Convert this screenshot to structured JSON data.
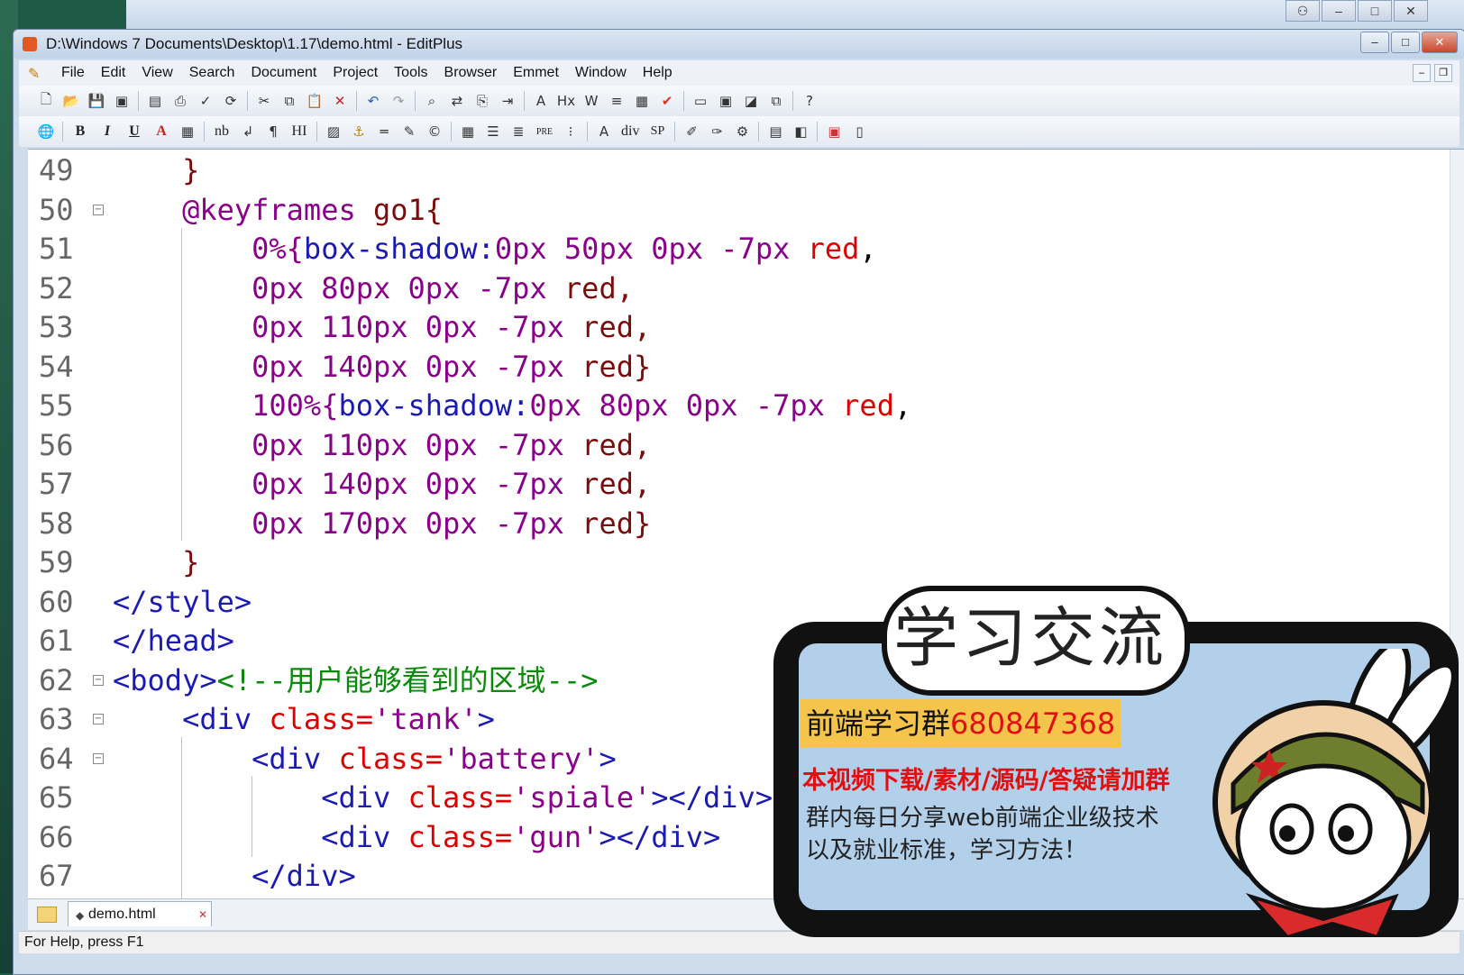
{
  "window": {
    "title": "D:\\Windows 7 Documents\\Desktop\\1.17\\demo.html - EditPlus",
    "controls": [
      "minimize-icon",
      "maximize-icon",
      "close-icon"
    ]
  },
  "menu": [
    "File",
    "Edit",
    "View",
    "Search",
    "Document",
    "Project",
    "Tools",
    "Browser",
    "Emmet",
    "Window",
    "Help"
  ],
  "toolbar1": [
    "new-file-icon",
    "open-icon",
    "save-icon",
    "save-all-icon",
    "print-preview-icon",
    "print-icon",
    "spellcheck-icon",
    "refresh-icon",
    "cut-icon",
    "copy-icon",
    "paste-icon",
    "delete-icon",
    "undo-icon",
    "redo-icon",
    "find-icon",
    "replace-icon",
    "find-in-files-icon",
    "goto-line-icon",
    "font-icon",
    "hex-icon",
    "word-wrap-icon",
    "line-number-icon",
    "column-icon",
    "check-icon",
    "view1-icon",
    "view2-icon",
    "view3-icon",
    "view4-icon",
    "help-icon"
  ],
  "toolbar2": {
    "text_buttons": [
      "B",
      "I",
      "U",
      "A",
      "nb",
      "HI",
      "div",
      "SP",
      "PRE"
    ]
  },
  "editor": {
    "lines": [
      {
        "n": "49",
        "fold": false,
        "tokens": [
          [
            "c-maroon",
            "    }"
          ]
        ]
      },
      {
        "n": "50",
        "fold": true,
        "tokens": [
          [
            "c-purple",
            "    @keyframes "
          ],
          [
            "c-maroon",
            "go1{"
          ]
        ]
      },
      {
        "n": "51",
        "fold": false,
        "tokens": [
          [
            "c-purple",
            "        0%{"
          ],
          [
            "c-navy",
            "box-shadow:"
          ],
          [
            "c-purple",
            "0px 50px 0px -7px "
          ],
          [
            "c-red",
            "red"
          ],
          [
            "c-black",
            ","
          ]
        ]
      },
      {
        "n": "52",
        "fold": false,
        "tokens": [
          [
            "c-purple",
            "        0px 80px 0px -7px "
          ],
          [
            "c-maroon",
            "red,"
          ]
        ]
      },
      {
        "n": "53",
        "fold": false,
        "tokens": [
          [
            "c-purple",
            "        0px 110px 0px -7px "
          ],
          [
            "c-maroon",
            "red,"
          ]
        ]
      },
      {
        "n": "54",
        "fold": false,
        "tokens": [
          [
            "c-purple",
            "        0px 140px 0px -7px "
          ],
          [
            "c-maroon",
            "red}"
          ]
        ]
      },
      {
        "n": "55",
        "fold": false,
        "tokens": [
          [
            "c-purple",
            "        100%{"
          ],
          [
            "c-navy",
            "box-shadow:"
          ],
          [
            "c-purple",
            "0px 80px 0px -7px "
          ],
          [
            "c-red",
            "red"
          ],
          [
            "c-black",
            ","
          ]
        ]
      },
      {
        "n": "56",
        "fold": false,
        "tokens": [
          [
            "c-purple",
            "        0px 110px 0px -7px "
          ],
          [
            "c-maroon",
            "red,"
          ]
        ]
      },
      {
        "n": "57",
        "fold": false,
        "tokens": [
          [
            "c-purple",
            "        0px 140px 0px -7px "
          ],
          [
            "c-maroon",
            "red,"
          ]
        ]
      },
      {
        "n": "58",
        "fold": false,
        "tokens": [
          [
            "c-purple",
            "        0px 170px 0px -7px "
          ],
          [
            "c-maroon",
            "red}"
          ]
        ]
      },
      {
        "n": "59",
        "fold": false,
        "tokens": [
          [
            "c-maroon",
            "    }"
          ]
        ]
      },
      {
        "n": "60",
        "fold": false,
        "tokens": [
          [
            "c-navy",
            "</style>"
          ]
        ]
      },
      {
        "n": "61",
        "fold": false,
        "tokens": [
          [
            "c-navy",
            "</head>"
          ]
        ]
      },
      {
        "n": "62",
        "fold": true,
        "tokens": [
          [
            "c-navy",
            "<body>"
          ],
          [
            "c-green",
            "<!--用户能够看到的区域-->"
          ]
        ]
      },
      {
        "n": "63",
        "fold": true,
        "tokens": [
          [
            "c-navy",
            "    <div "
          ],
          [
            "c-red",
            "class="
          ],
          [
            "c-purple",
            "'tank'"
          ],
          [
            "c-navy",
            ">"
          ]
        ]
      },
      {
        "n": "64",
        "fold": true,
        "tokens": [
          [
            "c-navy",
            "        <div "
          ],
          [
            "c-red",
            "class="
          ],
          [
            "c-purple",
            "'battery'"
          ],
          [
            "c-navy",
            ">"
          ]
        ]
      },
      {
        "n": "65",
        "fold": false,
        "tokens": [
          [
            "c-navy",
            "            <div "
          ],
          [
            "c-red",
            "class="
          ],
          [
            "c-purple",
            "'spiale'"
          ],
          [
            "c-navy",
            "></div>"
          ]
        ]
      },
      {
        "n": "66",
        "fold": false,
        "tokens": [
          [
            "c-navy",
            "            <div "
          ],
          [
            "c-red",
            "class="
          ],
          [
            "c-purple",
            "'gun'"
          ],
          [
            "c-navy",
            "></div>"
          ]
        ]
      },
      {
        "n": "67",
        "fold": false,
        "tokens": [
          [
            "c-navy",
            "        </div>"
          ]
        ]
      }
    ]
  },
  "tabs": [
    {
      "label": "demo.html"
    }
  ],
  "status": "For Help, press F1",
  "promo": {
    "heading": "学习交流",
    "group_label": "前端学习群",
    "group_number": "680847368",
    "line2": "本视频下载/素材/源码/答疑请加群",
    "line3a": "群内每日分享web前端企业级技术",
    "line3b": "以及就业标准，学习方法！"
  },
  "colors": {
    "promo_panel": "#b3d0ea",
    "promo_highlight": "#f5c44a",
    "promo_red": "#e01010"
  }
}
